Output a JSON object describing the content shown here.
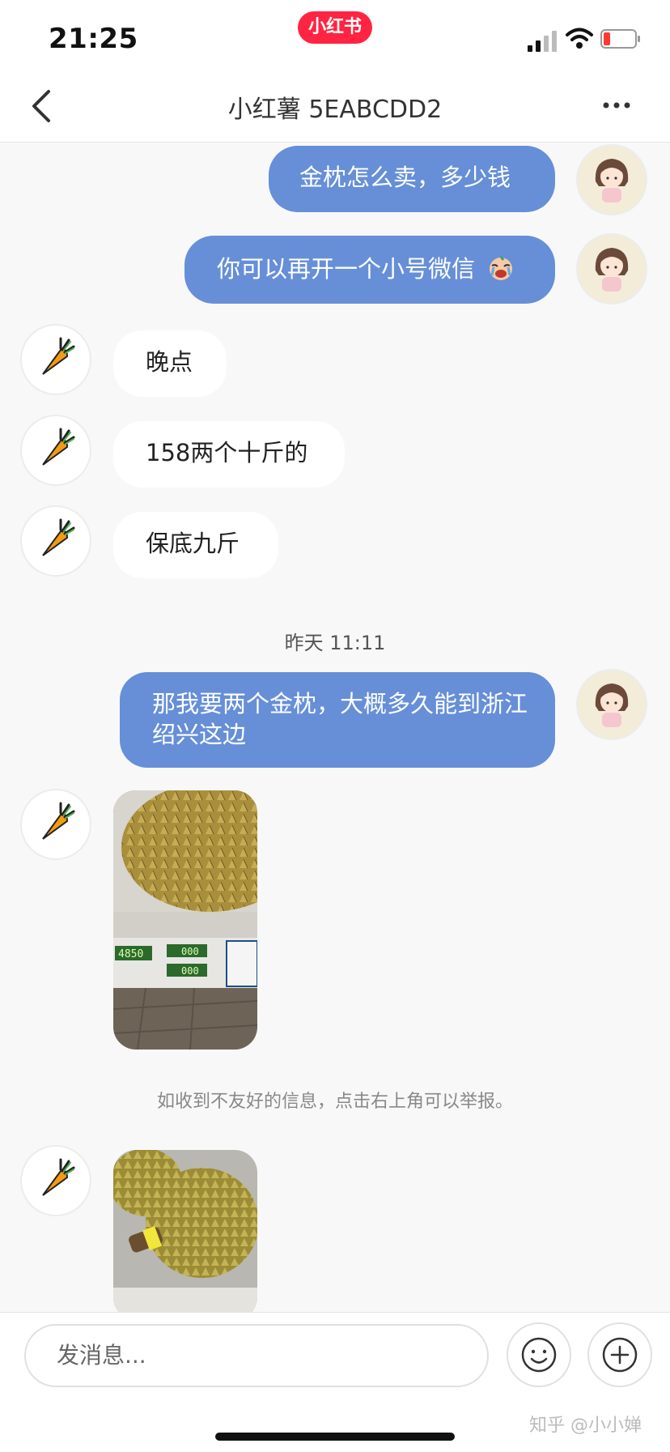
{
  "status": {
    "time": "21:25",
    "app_badge": "小红书"
  },
  "header": {
    "title": "小红薯 5EABCDD2",
    "back_icon": "chevron-left-icon",
    "more_icon": "ellipsis-icon"
  },
  "messages": [
    {
      "from": "me",
      "text": "金枕怎么卖，多少钱"
    },
    {
      "from": "me",
      "text": "你可以再开一个小号微信",
      "emoji": "crying-face-emoji"
    },
    {
      "from": "them",
      "text": "晚点"
    },
    {
      "from": "them",
      "text": "158两个十斤的"
    },
    {
      "from": "them",
      "text": "保底九斤"
    },
    {
      "timestamp": "昨天 11:11"
    },
    {
      "from": "me",
      "text": "那我要两个金枕，大概多久能到浙江绍兴这边"
    },
    {
      "from": "them",
      "image": "durian-on-scale-photo",
      "scale_readings": [
        "4850",
        "000",
        "000"
      ]
    },
    {
      "notice": "如收到不友好的信息，点击右上角可以举报。"
    },
    {
      "from": "them",
      "image": "durian-photo"
    }
  ],
  "input": {
    "placeholder": "发消息..."
  },
  "watermark": "知乎 @小小婵",
  "colors": {
    "my_bubble": "#668fd8",
    "their_bubble": "#ffffff",
    "brand": "#ff2442",
    "background": "#f8f8f8"
  }
}
